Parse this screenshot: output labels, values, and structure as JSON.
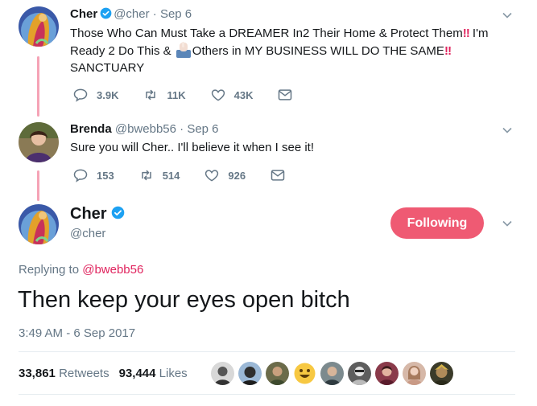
{
  "colors": {
    "accent": "#e0245e",
    "follow_button": "#ef5a73",
    "secondary_text": "#657786",
    "thread_line": "#f5a3b6"
  },
  "tweets": [
    {
      "name": "Cher",
      "handle": "@cher",
      "separator": "·",
      "date": "Sep 6",
      "verified": true,
      "text_part1": "Those Who Can Must Take a DREAMER In2 Their Home & Protect Them",
      "text_excl1": "‼",
      "text_part2": " I'm Ready 2 Do This & ",
      "text_part3": "Others in MY BUSINESS WILL DO THE SAME",
      "text_excl2": "‼",
      "text_part4": "SANCTUARY",
      "replies": "3.9K",
      "retweets": "11K",
      "likes": "43K"
    },
    {
      "name": "Brenda",
      "handle": "@bwebb56",
      "separator": "·",
      "date": "Sep 6",
      "text": "Sure you will Cher.. I'll believe it when I see it!",
      "replies": "153",
      "retweets": "514",
      "likes": "926"
    }
  ],
  "main": {
    "name": "Cher",
    "handle": "@cher",
    "follow_label": "Following",
    "replying_prefix": "Replying to",
    "replying_to": "@bwebb56",
    "text": "Then keep your eyes open bitch",
    "timestamp": "3:49 AM - 6 Sep 2017",
    "retweet_count": "33,861",
    "retweet_label": "Retweets",
    "like_count": "93,444",
    "like_label": "Likes"
  },
  "icons": {
    "reply": "reply-icon",
    "retweet": "retweet-icon",
    "like": "heart-icon",
    "dm": "envelope-icon",
    "menu": "chevron-down-icon",
    "verified": "verified-badge-icon"
  }
}
